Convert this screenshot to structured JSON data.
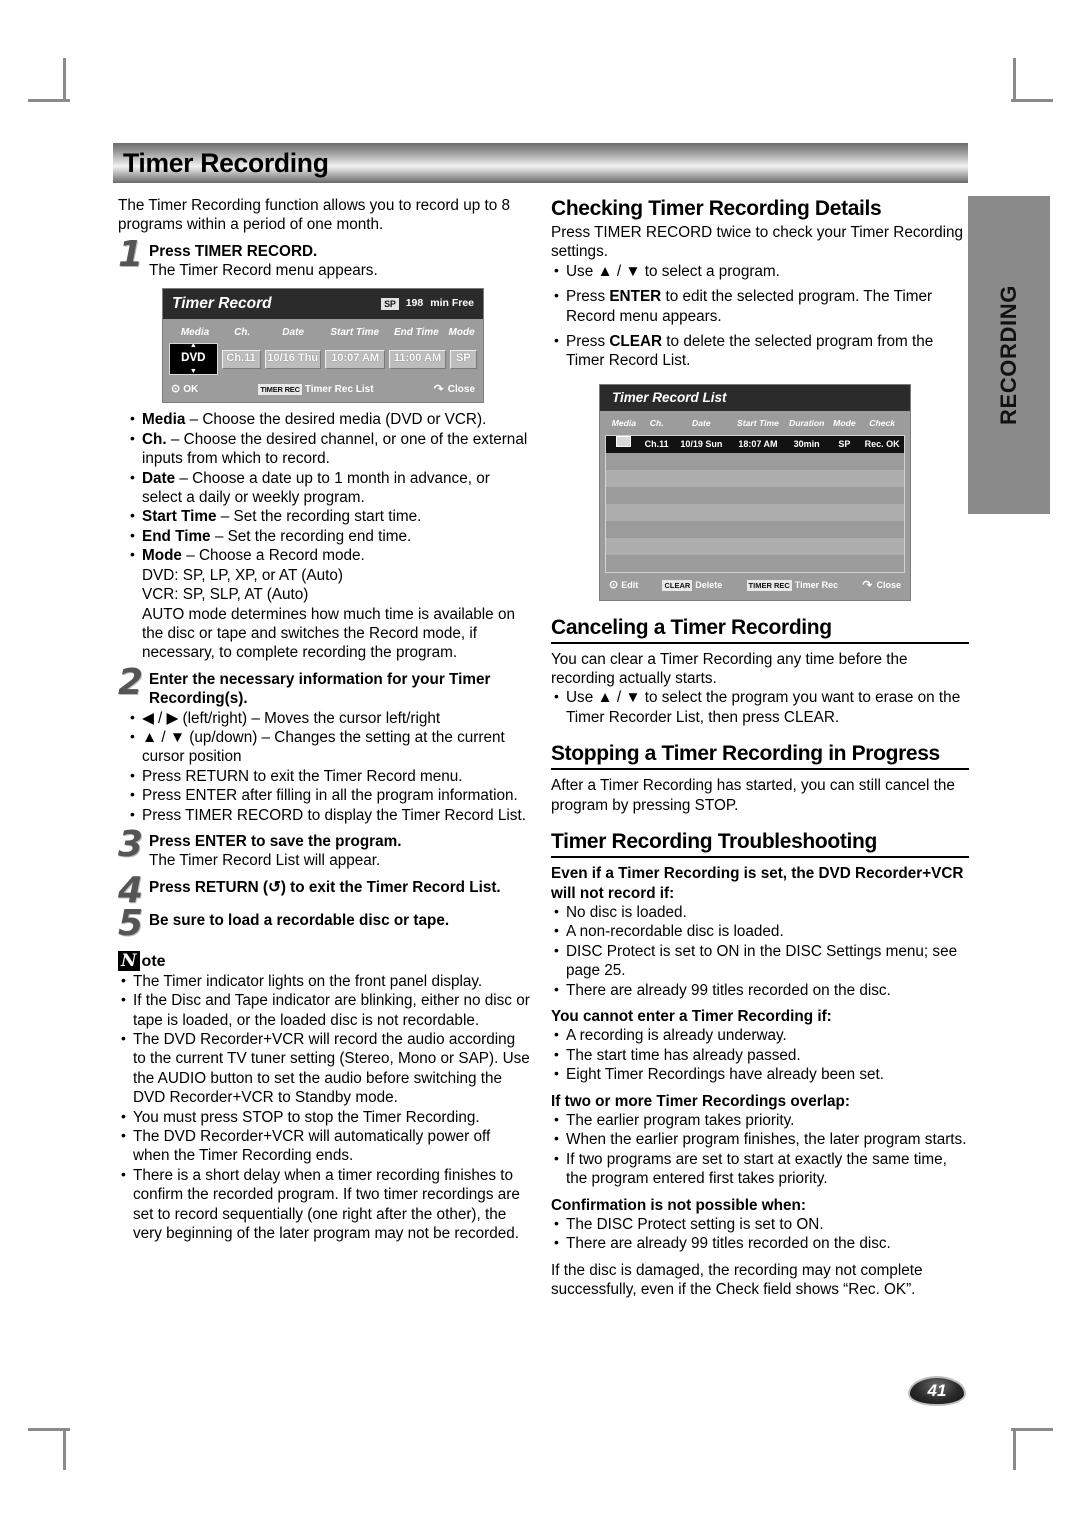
{
  "page": {
    "title": "Timer Recording",
    "number": "41",
    "side_tab": "RECORDING"
  },
  "left": {
    "intro": "The Timer Recording function allows you to record up to 8 programs within a period of one month.",
    "step1": {
      "num": "1",
      "title": "Press TIMER RECORD.",
      "body": "The Timer Record menu appears."
    },
    "osd_timer_record": {
      "title": "Timer Record",
      "mode_chip": "SP",
      "free_value": "198",
      "free_label": "min Free",
      "columns": [
        "Media",
        "Ch.",
        "Date",
        "Start Time",
        "End Time",
        "Mode"
      ],
      "values": {
        "media": "DVD",
        "ch": "Ch.11",
        "date": "10/16 Thu",
        "start_time": "10:07 AM",
        "end_time": "11:00 AM",
        "mode": "SP"
      },
      "footer": {
        "ok": "OK",
        "timer_rec_chip": "TIMER REC",
        "timer_rec_list": "Timer Rec List",
        "close": "Close"
      }
    },
    "field_bullets": [
      "<b>Media</b> – Choose the desired media (DVD or VCR).",
      "<b>Ch.</b> – Choose the desired channel, or one of the external inputs from which to record.",
      "<b>Date</b> – Choose a date up to 1 month in advance, or select a daily or weekly program.",
      "<b>Start Time</b> – Set the recording start time.",
      "<b>End Time</b> – Set the recording end time.",
      "<b>Mode</b> – Choose a Record mode."
    ],
    "mode_detail": [
      "DVD: SP, LP, XP, or AT (Auto)",
      "VCR: SP, SLP, AT (Auto)",
      "AUTO mode determines how much time is available on the disc or tape and switches the Record mode, if necessary, to complete recording the program."
    ],
    "step2": {
      "num": "2",
      "title": "Enter the necessary information for your Timer Recording(s).",
      "bullets": [
        "◀ / ▶ (left/right) – Moves the cursor left/right",
        "▲ / ▼ (up/down) – Changes the setting at the current cursor position",
        "Press RETURN to exit the Timer Record menu.",
        "Press ENTER after filling in all the program information.",
        "Press TIMER RECORD to display the Timer Record List."
      ]
    },
    "step3": {
      "num": "3",
      "title": "Press ENTER to save the program.",
      "body": "The Timer Record List will appear."
    },
    "step4": {
      "num": "4",
      "title": "Press RETURN (↺) to exit the Timer Record List."
    },
    "step5": {
      "num": "5",
      "title": "Be sure to load a recordable disc or tape."
    },
    "note": {
      "n": "N",
      "ote": "ote",
      "bullets": [
        "The Timer indicator lights on the front panel display.",
        "If the Disc and Tape indicator are blinking, either no disc or tape is loaded, or the loaded disc is not recordable.",
        "The DVD Recorder+VCR will record the audio according to the current TV tuner setting (Stereo, Mono or SAP). Use the AUDIO button to set the audio before switching the DVD Recorder+VCR to Standby mode.",
        "You must press STOP to stop the Timer Recording.",
        "The DVD Recorder+VCR will automatically power off when the Timer Recording ends.",
        "There is a short delay when a timer recording finishes to confirm the recorded program. If two timer recordings are set to record sequentially (one right after the other), the very beginning of the later program may not be recorded."
      ]
    }
  },
  "right": {
    "checking": {
      "heading": "Checking Timer Recording Details",
      "intro": "Press TIMER RECORD twice to check your Timer Recording settings.",
      "bullets": [
        "Use ▲ / ▼ to select a program.",
        "Press <b>ENTER</b> to edit the selected program. The Timer Record menu appears.",
        "Press <b>CLEAR</b> to delete the selected program from the Timer Record List."
      ]
    },
    "osd_timer_record_list": {
      "title": "Timer Record List",
      "columns": [
        "Media",
        "Ch.",
        "Date",
        "Start Time",
        "Duration",
        "Mode",
        "Check"
      ],
      "rows": [
        {
          "media": "media-chip",
          "ch": "Ch.11",
          "date": "10/19 Sun",
          "start_time": "18:07 AM",
          "duration": "30min",
          "mode": "SP",
          "check": "Rec. OK"
        }
      ],
      "empty_row_count": 7,
      "footer": {
        "edit": "Edit",
        "clear_chip": "CLEAR",
        "delete": "Delete",
        "timer_rec_chip": "TIMER REC",
        "timer_rec": "Timer Rec",
        "close": "Close"
      }
    },
    "canceling": {
      "heading": "Canceling a Timer Recording",
      "intro": "You can clear a Timer Recording any time before the recording actually starts.",
      "bullets": [
        "Use ▲ / ▼ to select the program you want to erase on the Timer Recorder List, then press CLEAR."
      ]
    },
    "stopping": {
      "heading": "Stopping a Timer Recording in Progress",
      "intro": "After a Timer Recording has started, you can still cancel the program by pressing STOP."
    },
    "troubleshooting": {
      "heading": "Timer Recording Troubleshooting",
      "group1": {
        "title": "Even if a Timer Recording is set, the DVD Recorder+VCR will not record if:",
        "bullets": [
          "No disc is loaded.",
          "A non-recordable disc is loaded.",
          "DISC Protect is set to ON in the DISC Settings menu; see page 25.",
          "There are already 99 titles recorded on the disc."
        ]
      },
      "group2": {
        "title": "You cannot enter a Timer Recording if:",
        "bullets": [
          "A recording is already underway.",
          "The start time has already passed.",
          "Eight Timer Recordings have already been set."
        ]
      },
      "group3": {
        "title": "If two or more Timer Recordings overlap:",
        "bullets": [
          "The earlier program takes priority.",
          "When the earlier program finishes, the later program starts.",
          "If two programs are set to start at exactly the same time, the program entered first takes priority."
        ]
      },
      "group4": {
        "title": "Confirmation is not possible when:",
        "bullets": [
          "The DISC Protect setting is set to ON.",
          "There are already 99 titles recorded on the disc."
        ]
      },
      "closing": "If the disc is damaged, the recording may not complete successfully, even if the Check field shows “Rec. OK”."
    }
  }
}
